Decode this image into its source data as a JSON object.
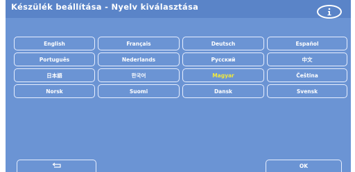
{
  "header": {
    "title": "Készülék beállítása - Nyelv kiválasztása",
    "info_icon": "info-icon"
  },
  "languages": [
    [
      "English",
      "Français",
      "Deutsch",
      "Español"
    ],
    [
      "Português",
      "Nederlands",
      "Русский",
      "中文"
    ],
    [
      "日本語",
      "한국어",
      "Magyar",
      "Čeština"
    ],
    [
      "Norsk",
      "Suomi",
      "Dansk",
      "Svensk"
    ]
  ],
  "selected_language": "Magyar",
  "footer": {
    "back_icon": "return-arrow-icon",
    "ok_label": "OK"
  },
  "colors": {
    "background": "#6b94d4",
    "title_bar": "#5a84c8",
    "selected_text": "#f2ea3a",
    "text": "#ffffff"
  }
}
